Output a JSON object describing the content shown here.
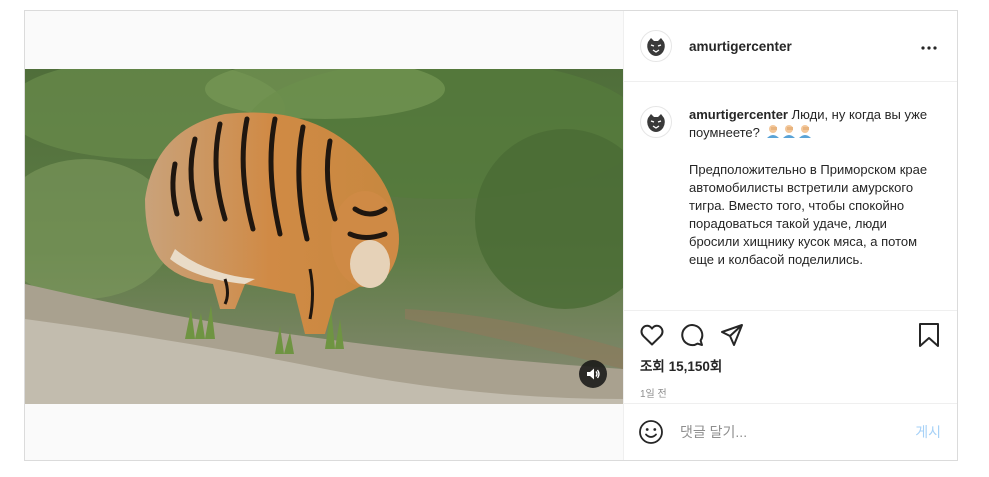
{
  "post": {
    "username": "amurtigercenter",
    "caption": {
      "username": "amurtigercenter",
      "first_line": "Люди, ну когда вы уже поумнеете?",
      "description": "Предположительно в Приморском крае автомобилисты встретили амурского тигра. Вместо того, чтобы спокойно порадоваться такой удаче, люди бросили хищнику кусок мяса, а потом еще и колбасой поделились."
    },
    "views_label": "조회 15,150회",
    "timestamp": "1일 전",
    "comment": {
      "placeholder": "댓글 달기...",
      "post_label": "게시"
    },
    "colors": {
      "post_button": "#a6d1f7",
      "muted_text": "#8e8e8e",
      "border": "#dbdbdb"
    },
    "icons": [
      "more-icon",
      "heart-icon",
      "comment-icon",
      "share-icon",
      "bookmark-icon",
      "volume-icon",
      "emoji-icon"
    ]
  }
}
